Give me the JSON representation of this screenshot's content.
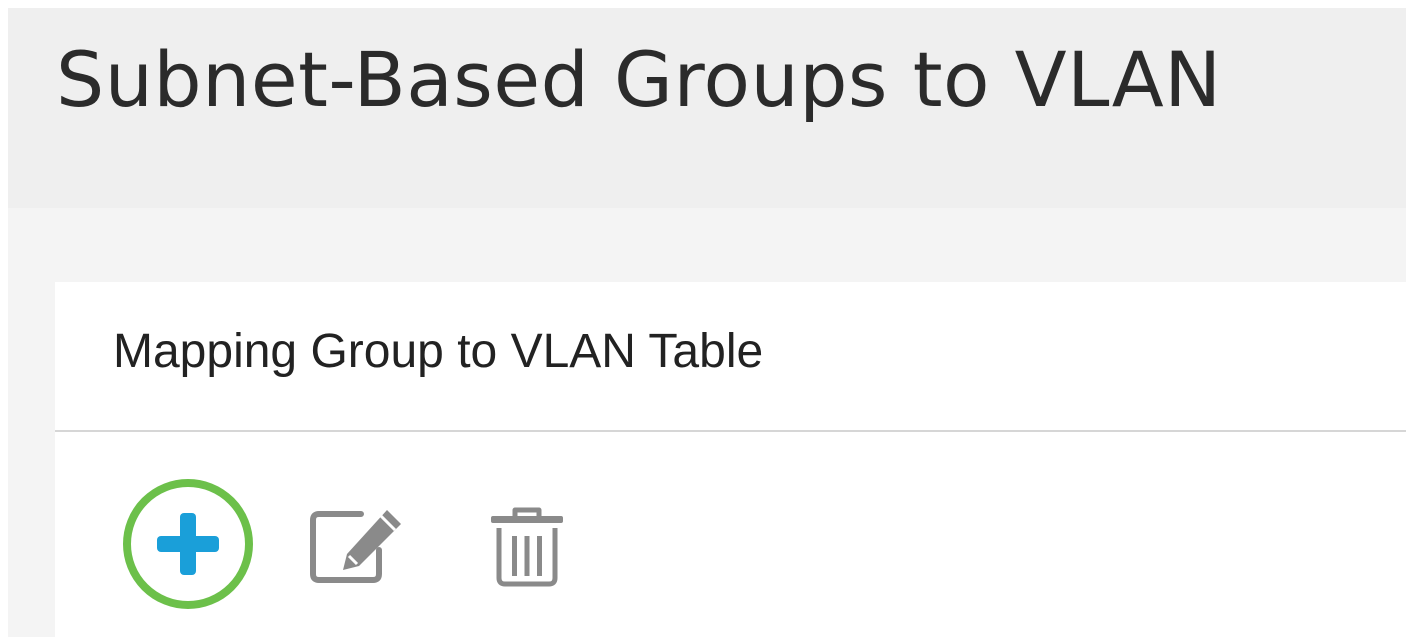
{
  "page": {
    "title": "Subnet-Based Groups to VLAN"
  },
  "table": {
    "title": "Mapping Group to VLAN Table"
  },
  "toolbar": {
    "add_icon": "plus-icon",
    "edit_icon": "edit-icon",
    "delete_icon": "trash-icon"
  },
  "colors": {
    "accent": "#1a9fd9",
    "highlight": "#6cc04a",
    "icon_gray": "#8a8a8a"
  }
}
